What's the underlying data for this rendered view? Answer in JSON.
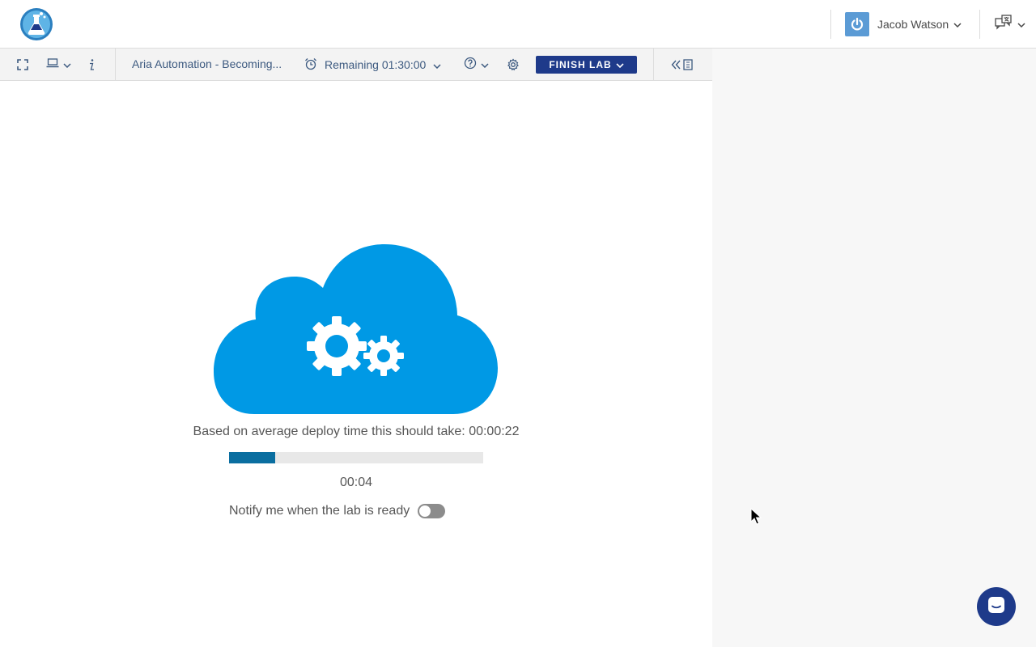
{
  "header": {
    "logo_icon": "lab-flask-icon",
    "user_name": "Jacob Watson",
    "user_icon": "power-icon",
    "language_icon": "language-icon"
  },
  "toolbar": {
    "fullscreen_icon": "fullscreen-icon",
    "console_icon": "laptop-icon",
    "info_icon": "info-icon",
    "lab_title": "Aria Automation - Becoming...",
    "remaining_label": "Remaining 01:30:00",
    "help_icon": "help-icon",
    "settings_icon": "gear-icon",
    "finish_label": "FINISH LAB",
    "collapse_icon": "collapse-manual-icon"
  },
  "deploy": {
    "estimate_text": "Based on average deploy time this should take: 00:00:22",
    "progress_fraction": 0.18,
    "elapsed": "00:04",
    "notify_label": "Notify me when the lab is ready",
    "notify_enabled": false
  },
  "colors": {
    "accent": "#1e3a8a",
    "cloud": "#0099e5",
    "progress": "#0a6ea0"
  }
}
